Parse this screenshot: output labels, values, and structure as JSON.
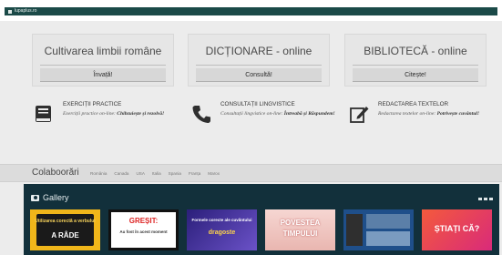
{
  "browser": {
    "url": "lupaplus.ro"
  },
  "cards": [
    {
      "title": "Cultivarea limbii române",
      "button": "Învață!"
    },
    {
      "title": "DICȚIONARE - online",
      "button": "Consultă!"
    },
    {
      "title": "BIBLIOTECĂ - online",
      "button": "Citește!"
    }
  ],
  "features": [
    {
      "icon": "book-icon",
      "title": "EXERCIȚII PRACTICE",
      "desc_label": "Exerciții practice on-line:",
      "desc_value": "Chibzuiește și rezolvă!"
    },
    {
      "icon": "phone-icon",
      "title": "CONSULTAȚII LINGVISTICE",
      "desc_label": "Consultații lingvistice on-line:",
      "desc_value": "Întreabă și Răspundem!"
    },
    {
      "icon": "edit-icon",
      "title": "REDACTAREA TEXTELOR",
      "desc_label": "Redactarea textelor on-line:",
      "desc_value": "Potrivește cuvântul!"
    }
  ],
  "partners": {
    "title": "Colaboorări",
    "items": [
      "România",
      "Canada",
      "USA",
      "Italia",
      "Spania",
      "Franța",
      "Marox"
    ]
  },
  "gallery": {
    "title": "Gallery",
    "thumbs": [
      {
        "line1": "Utilizarea corectă a verbului",
        "line2": "A RÂDE",
        "bg": "#f0b61a"
      },
      {
        "line1": "GREȘIT:",
        "line2": "Au fost în acest moment",
        "bg": "#ffffff"
      },
      {
        "line1": "Formele corecte ale cuvântului",
        "line2": "dragoste",
        "bg": "#4a3aa8"
      },
      {
        "line1": "POVESTEA",
        "line2": "TIMPULUI",
        "bg": "#f3c8c4"
      },
      {
        "line1": "",
        "line2": "",
        "bg": "#1f4f8a"
      },
      {
        "line1": "ȘTIAȚI CĂ?",
        "line2": "",
        "bg": "#e83a5c"
      }
    ]
  }
}
